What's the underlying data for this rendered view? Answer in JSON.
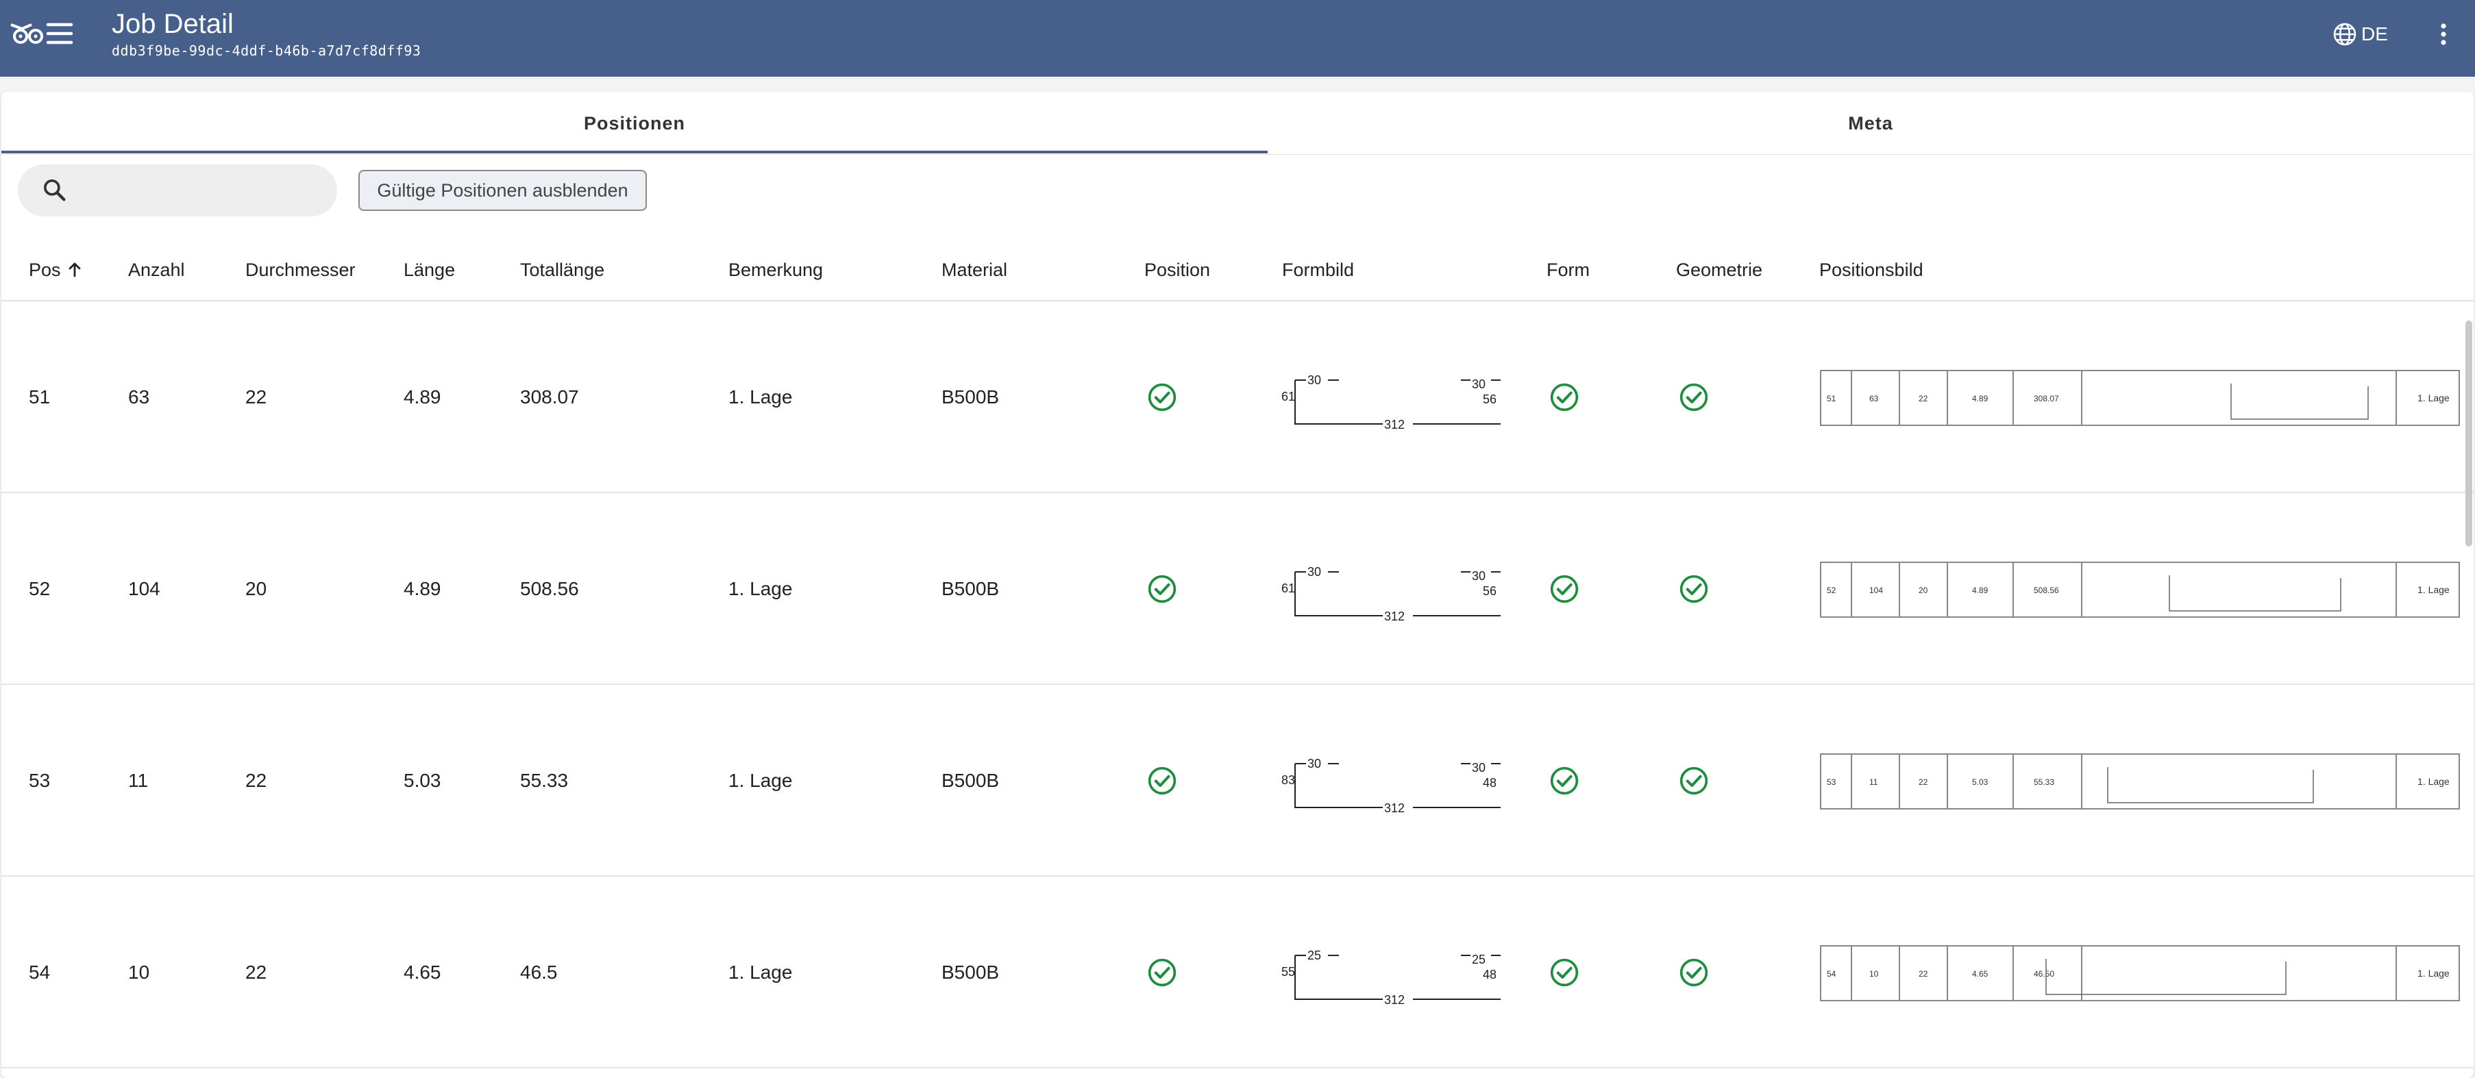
{
  "app_bar": {
    "title": "Job Detail",
    "job_id": "ddb3f9be-99dc-4ddf-b46b-a7d7cf8dff93",
    "language": "DE",
    "background_color": "#465f8b"
  },
  "tabs": [
    {
      "label": "Positionen",
      "active": true
    },
    {
      "label": "Meta",
      "active": false
    }
  ],
  "search": {
    "placeholder": "",
    "value": ""
  },
  "filter_button": {
    "label": "Gültige Positionen ausblenden"
  },
  "table": {
    "columns": {
      "pos": "Pos",
      "anzahl": "Anzahl",
      "durchmesser": "Durchmesser",
      "laenge": "Länge",
      "totallaenge": "Totallänge",
      "bemerkung": "Bemerkung",
      "material": "Material",
      "position": "Position",
      "formbild": "Formbild",
      "form": "Form",
      "geometrie": "Geometrie",
      "positionsbild": "Positionsbild"
    },
    "sort": {
      "column": "pos",
      "direction": "ascending"
    },
    "rows": [
      {
        "pos": "51",
        "anzahl": "63",
        "durchmesser": "22",
        "laenge": "4.89",
        "totallaenge": "308.07",
        "bemerkung": "1. Lage",
        "material": "B500B",
        "position_valid": true,
        "form_valid": true,
        "geometrie_valid": true,
        "shape": {
          "top_left": "30",
          "left": "61",
          "top_right": "30",
          "right": "56",
          "bottom": "312"
        },
        "posbild": {
          "totallaenge": "308.07"
        }
      },
      {
        "pos": "52",
        "anzahl": "104",
        "durchmesser": "20",
        "laenge": "4.89",
        "totallaenge": "508.56",
        "bemerkung": "1. Lage",
        "material": "B500B",
        "position_valid": true,
        "form_valid": true,
        "geometrie_valid": true,
        "shape": {
          "top_left": "30",
          "left": "61",
          "top_right": "30",
          "right": "56",
          "bottom": "312"
        },
        "posbild": {
          "totallaenge": "508.56"
        }
      },
      {
        "pos": "53",
        "anzahl": "11",
        "durchmesser": "22",
        "laenge": "5.03",
        "totallaenge": "55.33",
        "bemerkung": "1. Lage",
        "material": "B500B",
        "position_valid": true,
        "form_valid": true,
        "geometrie_valid": true,
        "shape": {
          "top_left": "30",
          "left": "83",
          "top_right": "30",
          "right": "48",
          "bottom": "312"
        },
        "posbild": {
          "totallaenge": "55.33"
        }
      },
      {
        "pos": "54",
        "anzahl": "10",
        "durchmesser": "22",
        "laenge": "4.65",
        "totallaenge": "46.5",
        "bemerkung": "1. Lage",
        "material": "B500B",
        "position_valid": true,
        "form_valid": true,
        "geometrie_valid": true,
        "shape": {
          "top_left": "25",
          "left": "55",
          "top_right": "25",
          "right": "48",
          "bottom": "312"
        },
        "posbild": {
          "totallaenge": "46.50"
        }
      }
    ]
  },
  "colors": {
    "valid": "#1e8e3e",
    "accent": "#465f8b"
  }
}
